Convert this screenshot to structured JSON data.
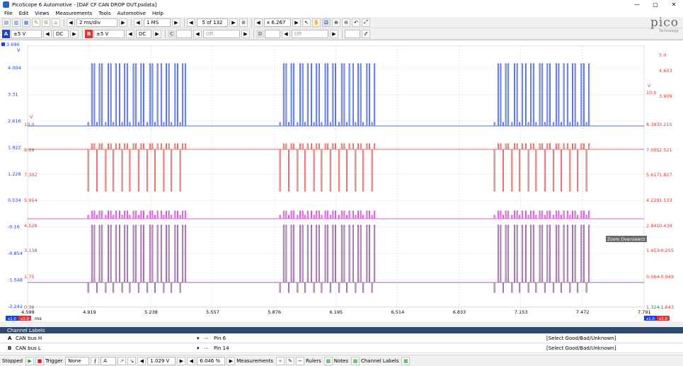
{
  "window": {
    "title": "PicoScope 6 Automotive - [DAF CF CAN DROP OUT.psdata]",
    "min": "—",
    "max": "▢",
    "close": "✕"
  },
  "menu": [
    "File",
    "Edit",
    "Views",
    "Measurements",
    "Tools",
    "Automotive",
    "Help"
  ],
  "toolbar": {
    "timebase": "2 ms/div",
    "samples": "1 MS",
    "buffer": "5 of 132",
    "zoom": "x 6.267"
  },
  "channels": [
    {
      "id": "A",
      "color": "#1f3fd0",
      "range": "±5 V",
      "coupling": "DC"
    },
    {
      "id": "B",
      "color": "#d83838",
      "range": "±5 V",
      "coupling": "DC"
    },
    {
      "id": "C",
      "color": "#cc33cc",
      "range": "",
      "coupling": "Off"
    },
    {
      "id": "D",
      "color": "#7a3a8a",
      "range": "",
      "coupling": "Off"
    }
  ],
  "logo": {
    "brand": "pico",
    "sub": "Technology"
  },
  "plot": {
    "cursor_top": "3.690",
    "unit": "V",
    "unit_right": "V",
    "left_axis1": [
      "4.004",
      "3.31",
      "2.616",
      "1.922",
      "1.228",
      "0.534",
      "-0.16",
      "-0.854",
      "-1.548",
      "-2.242"
    ],
    "left_axis2": [
      "10.0",
      "8.69",
      "7.302",
      "5.914",
      "4.526",
      "3.138",
      "1.75",
      "0.36"
    ],
    "right_axis1": [
      "10.0",
      "8.393",
      "7.005",
      "5.617",
      "4.229",
      "2.841",
      "1.453",
      "0.064",
      "1.324"
    ],
    "right_axis2": [
      "5.0",
      "4.603",
      "3.909",
      "3.215",
      "2.521",
      "1.827",
      "1.133",
      "0.439",
      "-0.255",
      "-0.949",
      "-1.643"
    ],
    "x_axis": [
      "4.599",
      "4.919",
      "5.238",
      "5.557",
      "5.876",
      "6.195",
      "6.514",
      "6.833",
      "7.153",
      "7.472",
      "7.791"
    ],
    "x_unit": "ms",
    "zoom_overview": "Zoom Overview",
    "zoom_overview_btns": "⊡ ✕",
    "bottom_left": "x1.0",
    "bottom_right": "x1.0"
  },
  "channel_labels": {
    "title": "Channel Labels",
    "rows": [
      {
        "ch": "A",
        "name": "CAN bus H",
        "pin": "Pin 6",
        "rating": "[Select Good/Bad/Unknown]"
      },
      {
        "ch": "B",
        "name": "CAN bus L",
        "pin": "Pin 14",
        "rating": "[Select Good/Bad/Unknown]"
      }
    ]
  },
  "status": {
    "state": "Stopped",
    "trigger_label": "Trigger",
    "trigger_mode": "None",
    "trigger_ch": "A",
    "level": "1.029 V",
    "pretrigger": "6.046 %",
    "measurements": "Measurements",
    "rulers": "Rulers",
    "notes": "Notes",
    "channel_labels": "Channel Labels"
  }
}
